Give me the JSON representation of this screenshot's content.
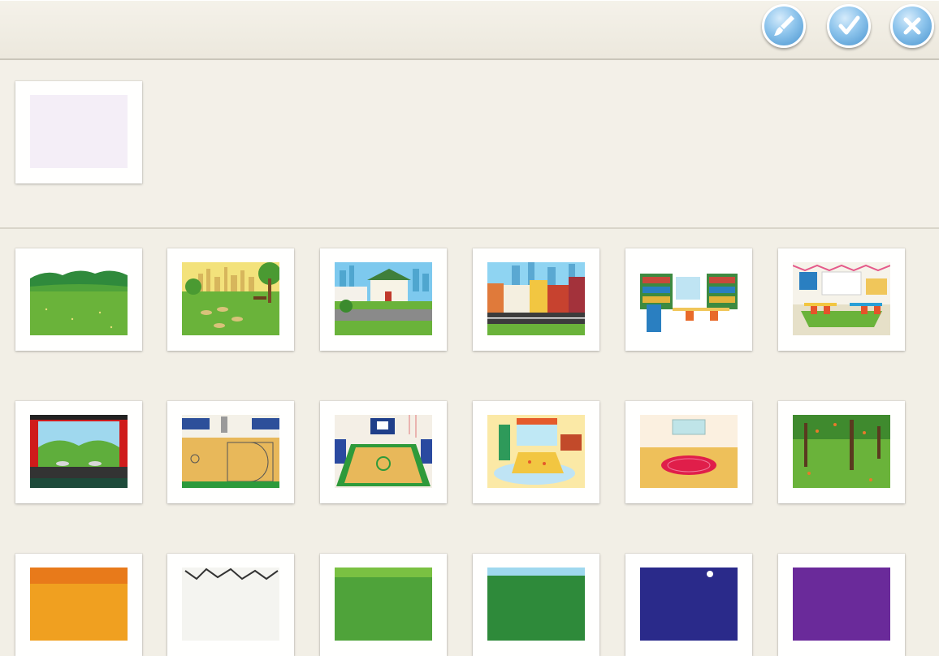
{
  "toolbar": {
    "buttons": [
      {
        "name": "paint-brush-button",
        "icon": "paint-brush-icon"
      },
      {
        "name": "confirm-button",
        "icon": "checkmark-icon"
      },
      {
        "name": "close-button",
        "icon": "close-icon"
      }
    ],
    "accent": "#5aa3da"
  },
  "selected_background": {
    "icon": "blank-background"
  },
  "backgrounds": [
    {
      "name": "meadow"
    },
    {
      "name": "city-park"
    },
    {
      "name": "suburb"
    },
    {
      "name": "city-street"
    },
    {
      "name": "library"
    },
    {
      "name": "classroom"
    },
    {
      "name": "theater-stage"
    },
    {
      "name": "gym-court"
    },
    {
      "name": "basketball-arena"
    },
    {
      "name": "bedroom"
    },
    {
      "name": "empty-room"
    },
    {
      "name": "orchard"
    },
    {
      "name": "autumn"
    },
    {
      "name": "bare-trees"
    },
    {
      "name": "garden"
    },
    {
      "name": "forest"
    },
    {
      "name": "night-sky"
    },
    {
      "name": "purple-night"
    }
  ]
}
